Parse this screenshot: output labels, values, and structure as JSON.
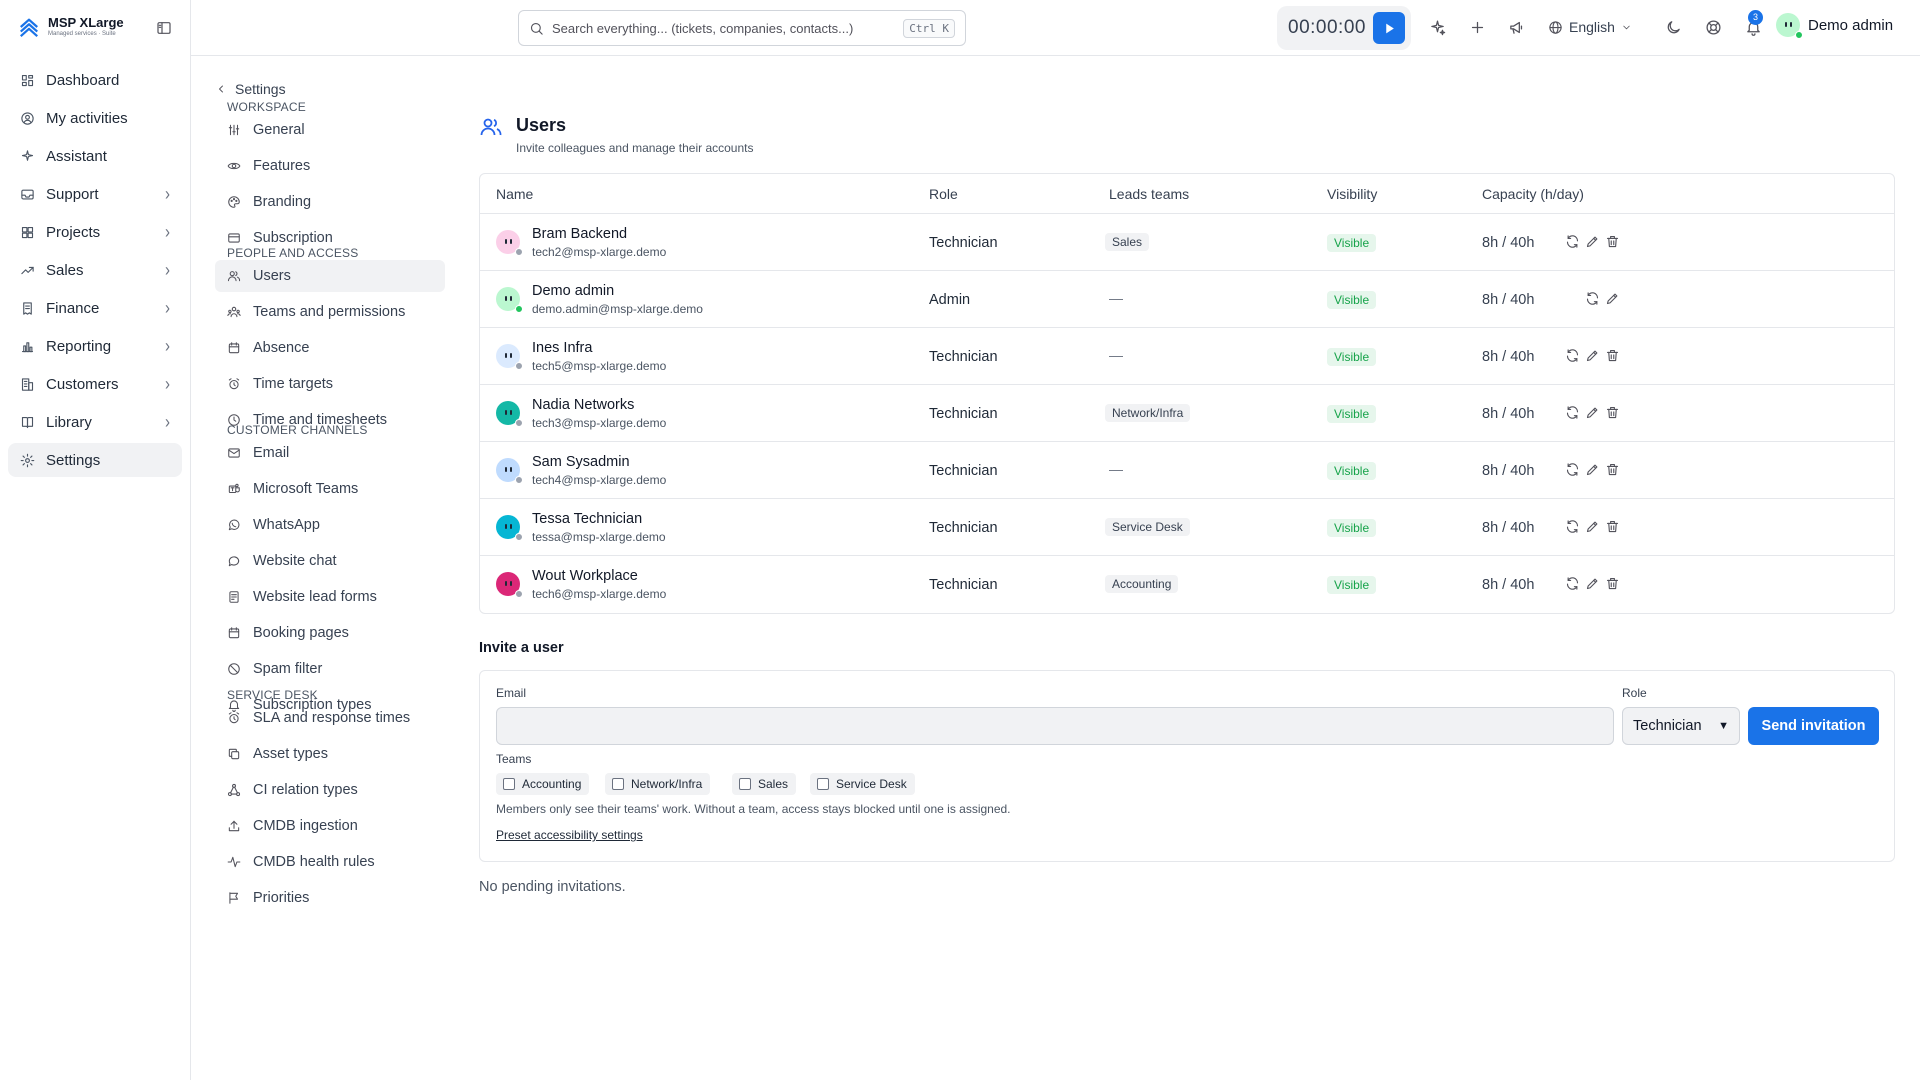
{
  "app": {
    "name": "MSP XLarge",
    "tagline": "Managed services · Suite"
  },
  "sidebar": {
    "items": [
      {
        "label": "Dashboard",
        "icon": "dashboard-icon",
        "chevron": false,
        "active": false
      },
      {
        "label": "My activities",
        "icon": "user-circle-icon",
        "chevron": false,
        "active": false
      },
      {
        "label": "Assistant",
        "icon": "sparkles-icon",
        "chevron": false,
        "active": false
      },
      {
        "label": "Support",
        "icon": "inbox-icon",
        "chevron": true,
        "active": false
      },
      {
        "label": "Projects",
        "icon": "projects-icon",
        "chevron": true,
        "active": false
      },
      {
        "label": "Sales",
        "icon": "trend-icon",
        "chevron": true,
        "active": false
      },
      {
        "label": "Finance",
        "icon": "receipt-icon",
        "chevron": true,
        "active": false
      },
      {
        "label": "Reporting",
        "icon": "bar-chart-icon",
        "chevron": true,
        "active": false
      },
      {
        "label": "Customers",
        "icon": "building-icon",
        "chevron": true,
        "active": false
      },
      {
        "label": "Library",
        "icon": "book-icon",
        "chevron": true,
        "active": false
      },
      {
        "label": "Settings",
        "icon": "gear-icon",
        "chevron": false,
        "active": true
      }
    ]
  },
  "topbar": {
    "search_placeholder": "Search everything... (tickets, companies, contacts...)",
    "search_shortcut": "Ctrl K",
    "timer": "00:00:00",
    "language": "English",
    "notifications_count": "3",
    "user_name": "Demo admin"
  },
  "settings_nav": {
    "back_label": "Settings",
    "sections": [
      {
        "title": "WORKSPACE",
        "items": [
          {
            "label": "General",
            "icon": "sliders-icon"
          },
          {
            "label": "Features",
            "icon": "eye-icon"
          },
          {
            "label": "Branding",
            "icon": "palette-icon"
          },
          {
            "label": "Subscription",
            "icon": "credit-card-icon"
          }
        ]
      },
      {
        "title": "PEOPLE AND ACCESS",
        "items": [
          {
            "label": "Users",
            "icon": "users-icon",
            "active": true
          },
          {
            "label": "Teams and permissions",
            "icon": "team-icon"
          },
          {
            "label": "Absence",
            "icon": "calendar-icon"
          },
          {
            "label": "Time targets",
            "icon": "alarm-clock-icon"
          },
          {
            "label": "Time and timesheets",
            "icon": "clock-icon"
          }
        ]
      },
      {
        "title": "CUSTOMER CHANNELS",
        "items": [
          {
            "label": "Email",
            "icon": "mail-icon"
          },
          {
            "label": "Microsoft Teams",
            "icon": "teams-icon"
          },
          {
            "label": "WhatsApp",
            "icon": "whatsapp-icon"
          },
          {
            "label": "Website chat",
            "icon": "chat-bubble-icon"
          },
          {
            "label": "Website lead forms",
            "icon": "form-icon"
          },
          {
            "label": "Booking pages",
            "icon": "calendar-icon"
          },
          {
            "label": "Spam filter",
            "icon": "shield-off-icon"
          },
          {
            "label": "Subscription types",
            "icon": "bell-icon"
          }
        ]
      },
      {
        "title": "SERVICE DESK",
        "items": [
          {
            "label": "SLA and response times",
            "icon": "alarm-clock-icon"
          },
          {
            "label": "Asset types",
            "icon": "copy-icon"
          },
          {
            "label": "CI relation types",
            "icon": "network-icon"
          },
          {
            "label": "CMDB ingestion",
            "icon": "upload-icon"
          },
          {
            "label": "CMDB health rules",
            "icon": "activity-icon"
          },
          {
            "label": "Priorities",
            "icon": "flag-icon"
          }
        ]
      }
    ]
  },
  "users_page": {
    "title": "Users",
    "subtitle": "Invite colleagues and manage their accounts",
    "columns": [
      "Name",
      "Role",
      "Leads teams",
      "Visibility",
      "Capacity (h/day)"
    ],
    "rows": [
      {
        "name": "Bram Backend",
        "email": "tech2@msp-xlarge.demo",
        "role": "Technician",
        "team": "Sales",
        "visibility": "Visible",
        "capacity": "8h / 40h",
        "avatar_color": "#fbcfe8",
        "status_color": "#9ca3af",
        "deletable": true
      },
      {
        "name": "Demo admin",
        "email": "demo.admin@msp-xlarge.demo",
        "role": "Admin",
        "team": "—",
        "visibility": "Visible",
        "capacity": "8h / 40h",
        "avatar_color": "#bbf7d0",
        "status_color": "#22c55e",
        "deletable": false
      },
      {
        "name": "Ines Infra",
        "email": "tech5@msp-xlarge.demo",
        "role": "Technician",
        "team": "—",
        "visibility": "Visible",
        "capacity": "8h / 40h",
        "avatar_color": "#dbeafe",
        "status_color": "#9ca3af",
        "deletable": true
      },
      {
        "name": "Nadia Networks",
        "email": "tech3@msp-xlarge.demo",
        "role": "Technician",
        "team": "Network/Infra",
        "visibility": "Visible",
        "capacity": "8h / 40h",
        "avatar_color": "#14b8a6",
        "status_color": "#9ca3af",
        "deletable": true
      },
      {
        "name": "Sam Sysadmin",
        "email": "tech4@msp-xlarge.demo",
        "role": "Technician",
        "team": "—",
        "visibility": "Visible",
        "capacity": "8h / 40h",
        "avatar_color": "#bfdbfe",
        "status_color": "#9ca3af",
        "deletable": true
      },
      {
        "name": "Tessa Technician",
        "email": "tessa@msp-xlarge.demo",
        "role": "Technician",
        "team": "Service Desk",
        "visibility": "Visible",
        "capacity": "8h / 40h",
        "avatar_color": "#06b6d4",
        "status_color": "#9ca3af",
        "deletable": true
      },
      {
        "name": "Wout Workplace",
        "email": "tech6@msp-xlarge.demo",
        "role": "Technician",
        "team": "Accounting",
        "visibility": "Visible",
        "capacity": "8h / 40h",
        "avatar_color": "#db2777",
        "status_color": "#9ca3af",
        "deletable": true
      }
    ]
  },
  "invite": {
    "title": "Invite a user",
    "email_label": "Email",
    "email_value": "",
    "role_label": "Role",
    "role_value": "Technician",
    "send_label": "Send invitation",
    "teams_label": "Teams",
    "teams": [
      "Accounting",
      "Network/Infra",
      "Sales",
      "Service Desk"
    ],
    "note": "Members only see their teams' work. Without a team, access stays blocked until one is assigned.",
    "preset_link": "Preset accessibility settings",
    "no_pending": "No pending invitations."
  },
  "colors": {
    "accent": "#1a73e8",
    "visible_text": "#16a34a",
    "visible_bg": "#e6f6ec"
  }
}
